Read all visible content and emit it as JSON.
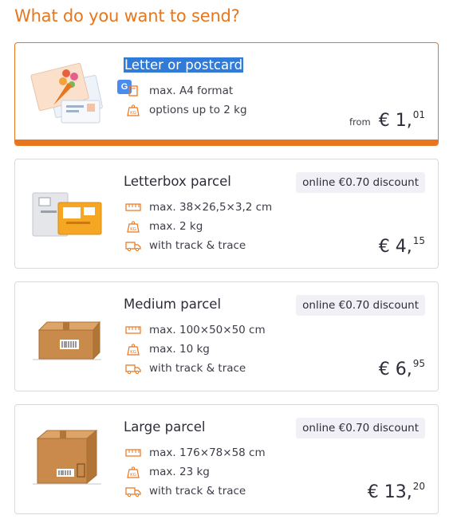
{
  "page": {
    "title": "What do you want to send?"
  },
  "colors": {
    "accent": "#e8761e",
    "highlight": "#2f7bd7",
    "discount_bg": "#f0f0f6"
  },
  "options": [
    {
      "title": "Letter or postcard",
      "specs": [
        {
          "icon": "format-icon",
          "text": "max. A4 format"
        },
        {
          "icon": "weight-icon",
          "text": "options up to 2 kg"
        }
      ],
      "price": {
        "prefix": "from",
        "main": "€ 1,",
        "cents": "01"
      },
      "selected": true
    },
    {
      "title": "Letterbox parcel",
      "discount": "online €0.70 discount",
      "specs": [
        {
          "icon": "ruler-icon",
          "text": "max. 38×26,5×3,2 cm"
        },
        {
          "icon": "weight-icon",
          "text": "max. 2 kg"
        },
        {
          "icon": "delivery-van-icon",
          "text": "with track & trace"
        }
      ],
      "price": {
        "main": "€ 4,",
        "cents": "15"
      }
    },
    {
      "title": "Medium parcel",
      "discount": "online €0.70 discount",
      "specs": [
        {
          "icon": "ruler-icon",
          "text": "max. 100×50×50 cm"
        },
        {
          "icon": "weight-icon",
          "text": "max. 10 kg"
        },
        {
          "icon": "delivery-van-icon",
          "text": "with track & trace"
        }
      ],
      "price": {
        "main": "€ 6,",
        "cents": "95"
      }
    },
    {
      "title": "Large parcel",
      "discount": "online €0.70 discount",
      "specs": [
        {
          "icon": "ruler-icon",
          "text": "max. 176×78×58 cm"
        },
        {
          "icon": "weight-icon",
          "text": "max. 23 kg"
        },
        {
          "icon": "delivery-van-icon",
          "text": "with track & trace"
        }
      ],
      "price": {
        "main": "€ 13,",
        "cents": "20"
      }
    }
  ]
}
